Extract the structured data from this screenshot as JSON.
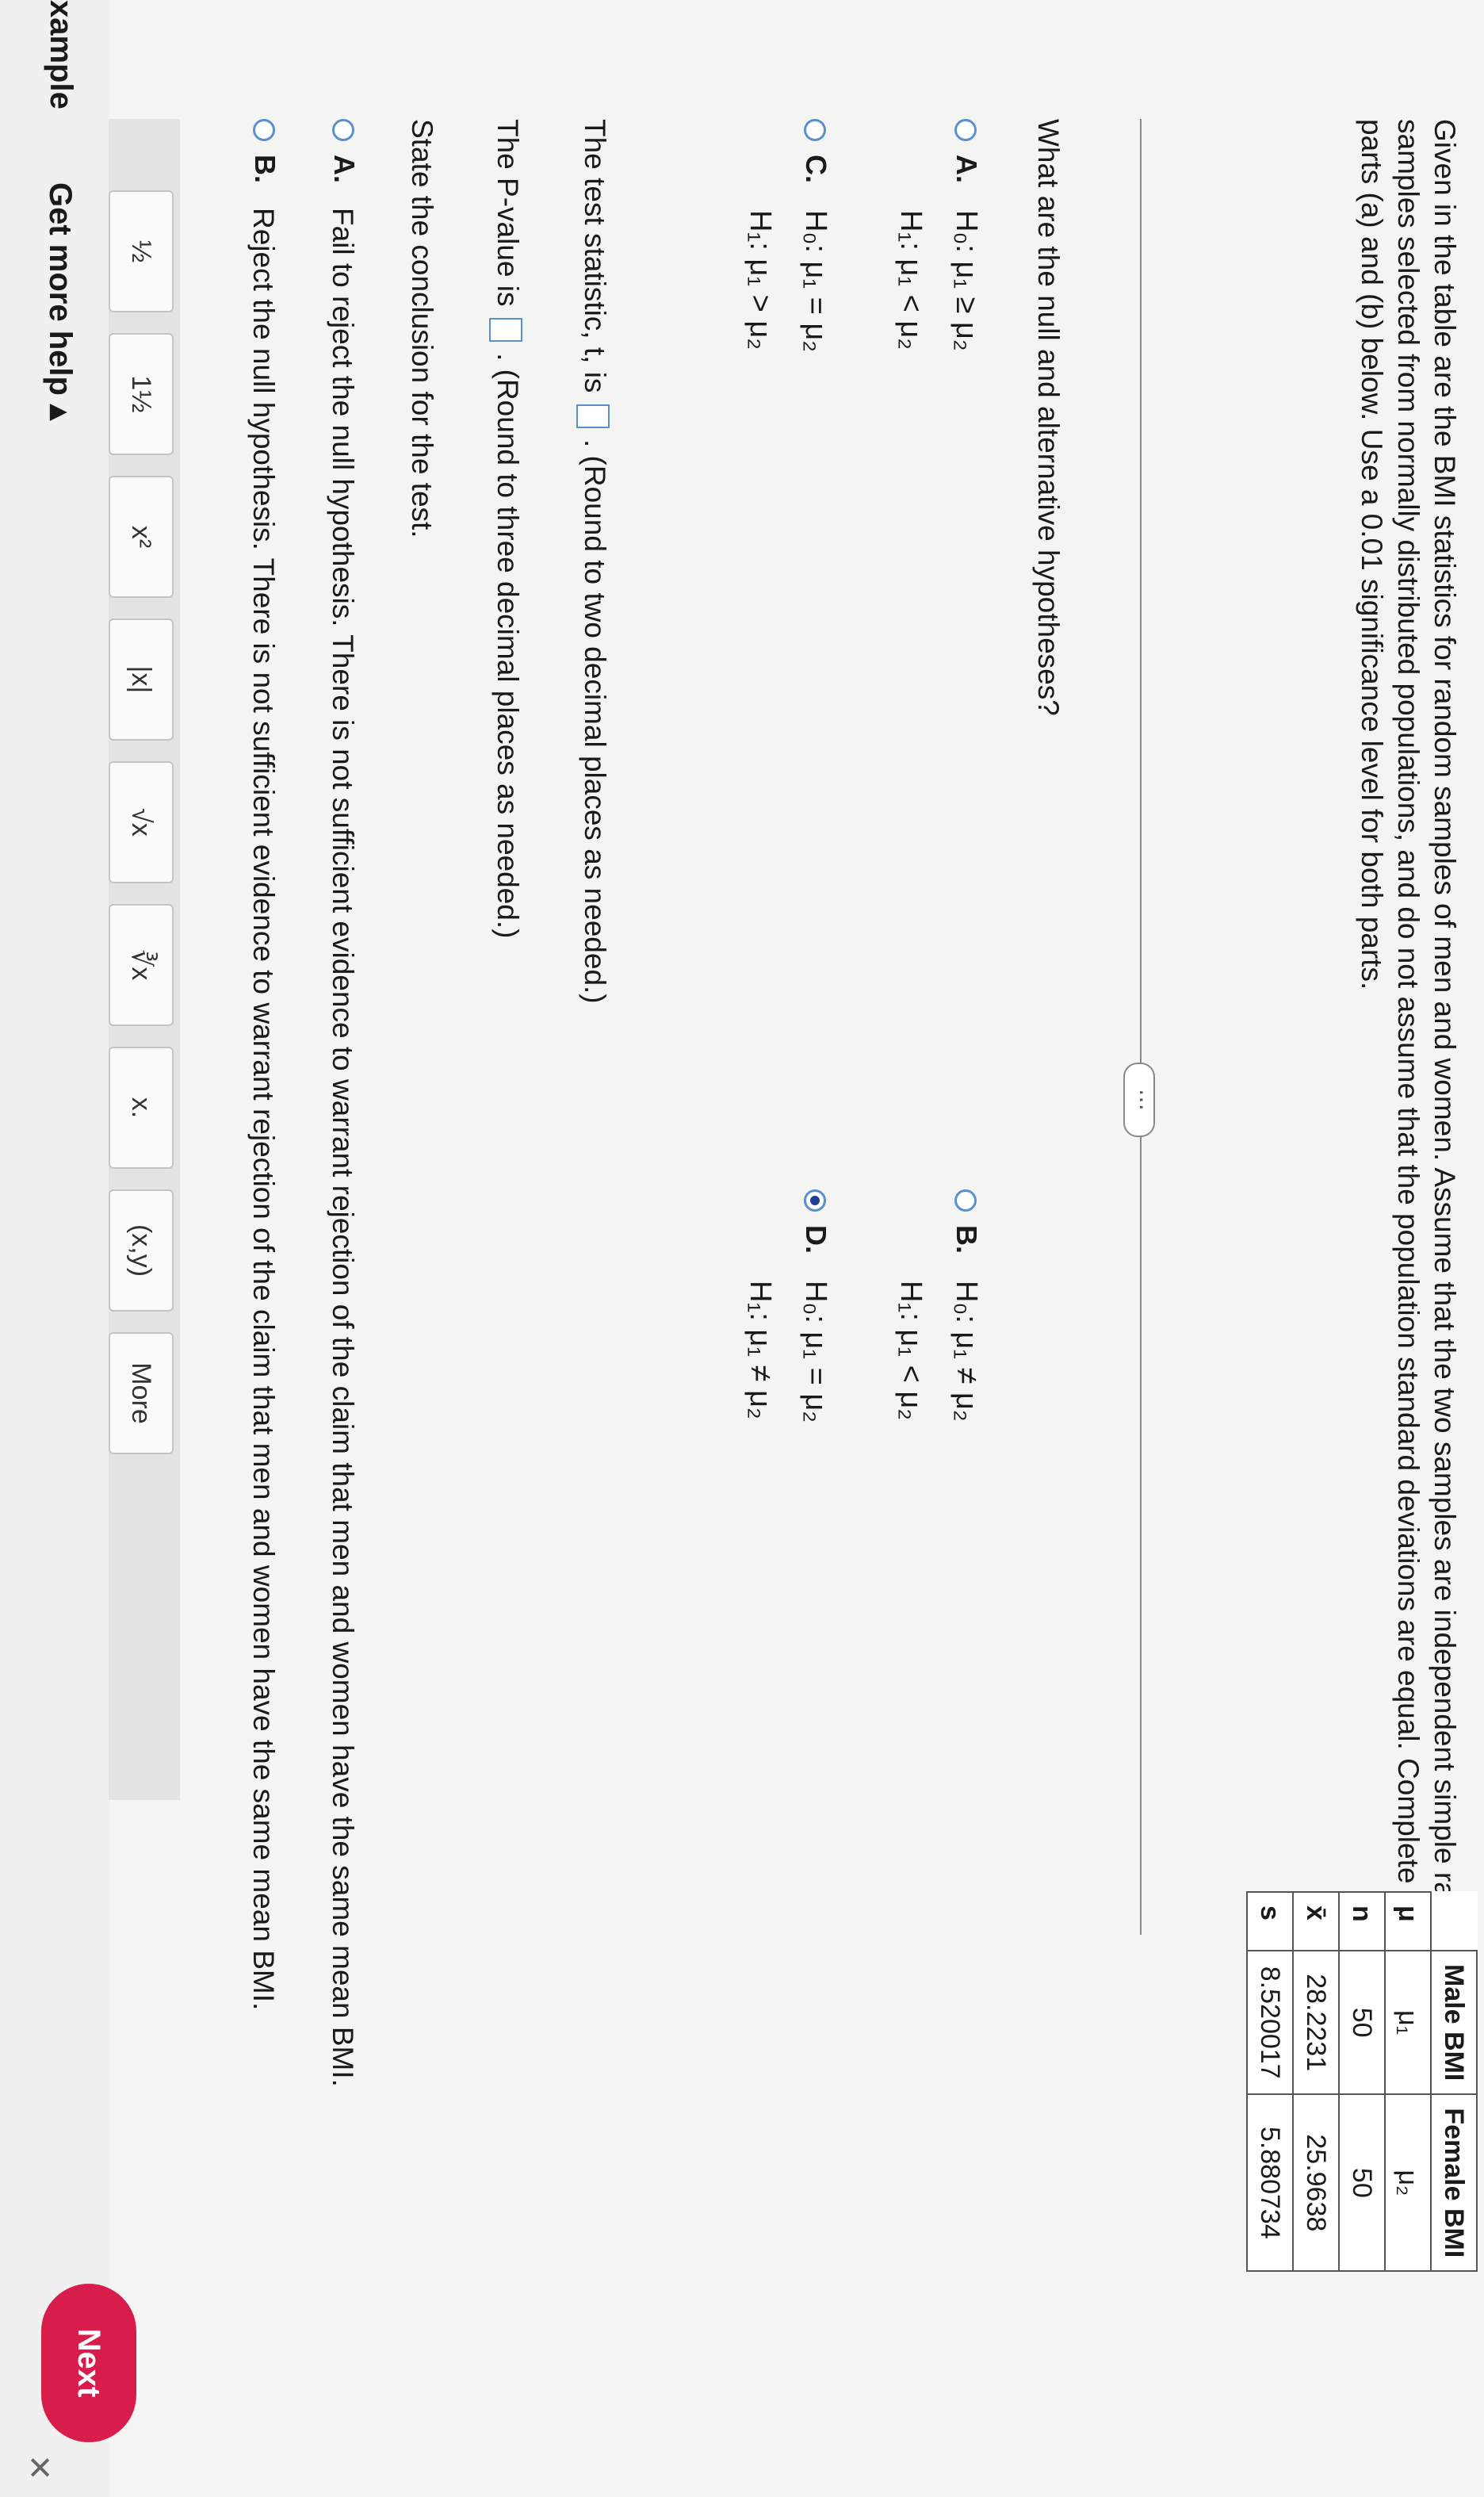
{
  "intro": {
    "line1": "Given in the table are the BMI statistics for random samples of men and women. Assume that the two samples are independent simple random",
    "line2": "samples selected from normally distributed populations, and do not assume that the population standard deviations are equal. Complete",
    "line3": "parts (a) and (b) below. Use a 0.01 significance level for both parts."
  },
  "table": {
    "headers": [
      "",
      "Male BMI",
      "Female BMI"
    ],
    "rows": [
      {
        "label": "μ",
        "male": "μ₁",
        "female": "μ₂"
      },
      {
        "label": "n",
        "male": "50",
        "female": "50"
      },
      {
        "label": "x̄",
        "male": "28.2231",
        "female": "25.9638"
      },
      {
        "label": "s",
        "male": "8.520017",
        "female": "5.880734"
      }
    ]
  },
  "more_indicator": "⋯",
  "question1": "What are the null and alternative hypotheses?",
  "options": {
    "A": {
      "letter": "A.",
      "h0": "H₀: μ₁ ≥ μ₂",
      "h1": "H₁: μ₁ < μ₂"
    },
    "B": {
      "letter": "B.",
      "h0": "H₀: μ₁ ≠ μ₂",
      "h1": "H₁: μ₁ < μ₂"
    },
    "C": {
      "letter": "C.",
      "h0": "H₀: μ₁ = μ₂",
      "h1": "H₁: μ₁ > μ₂"
    },
    "D": {
      "letter": "D.",
      "h0": "H₀: μ₁ = μ₂",
      "h1": "H₁: μ₁ ≠ μ₂"
    },
    "selected": "D"
  },
  "test_stat": {
    "before": "The test statistic, t, is",
    "after": ". (Round to two decimal places as needed.)"
  },
  "p_value": {
    "before": "The P-value is",
    "after": ". (Round to three decimal places as needed.)"
  },
  "conclusion_prompt": "State the conclusion for the test.",
  "conclusions": {
    "A": {
      "letter": "A.",
      "text": "Fail to reject the null hypothesis. There is not sufficient evidence to warrant rejection of the claim that men and women have the same mean BMI."
    },
    "B": {
      "letter": "B.",
      "text": "Reject the null hypothesis. There is not sufficient evidence to warrant rejection of the claim that men and women have the same mean BMI."
    }
  },
  "toolbar": {
    "tools": [
      "½",
      "1½",
      "x²",
      "|x|",
      "√x",
      "∛x",
      "x.",
      "(x,y)"
    ],
    "more_label": "More"
  },
  "footer": {
    "example_label": "xample",
    "help_label": "Get more help ▴",
    "next_label": "Next",
    "close_label": "✕"
  }
}
